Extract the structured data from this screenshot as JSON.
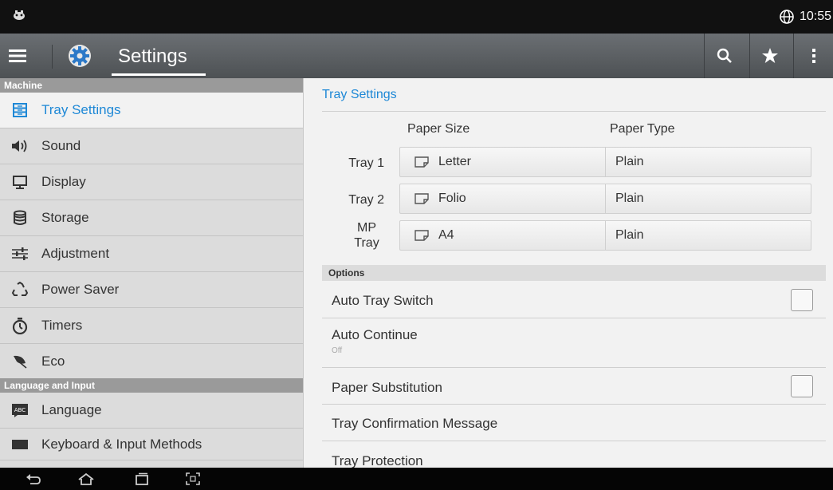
{
  "status_bar": {
    "time": "10:55"
  },
  "action_bar": {
    "title": "Settings"
  },
  "sidebar": {
    "section_machine": "Machine",
    "items": [
      {
        "label": "Tray Settings",
        "icon": "tray-icon"
      },
      {
        "label": "Sound",
        "icon": "speaker-icon"
      },
      {
        "label": "Display",
        "icon": "monitor-icon"
      },
      {
        "label": "Storage",
        "icon": "database-icon"
      },
      {
        "label": "Adjustment",
        "icon": "sliders-icon"
      },
      {
        "label": "Power Saver",
        "icon": "recycle-icon"
      },
      {
        "label": "Timers",
        "icon": "stopwatch-icon"
      },
      {
        "label": "Eco",
        "icon": "leaf-icon"
      }
    ],
    "section_language": "Language and Input",
    "language_items": [
      {
        "label": "Language",
        "icon": "abc-keyboard-icon"
      },
      {
        "label": "Keyboard & Input Methods",
        "icon": "keyboard-icon"
      }
    ]
  },
  "main": {
    "header": "Tray Settings",
    "col_paper_size": "Paper Size",
    "col_paper_type": "Paper Type",
    "trays": [
      {
        "label": "Tray 1",
        "size": "Letter",
        "type": "Plain"
      },
      {
        "label": "Tray 2",
        "size": "Folio",
        "type": "Plain"
      },
      {
        "label": "MP Tray",
        "size": "A4",
        "type": "Plain"
      }
    ],
    "options_header": "Options",
    "options": [
      {
        "label": "Auto Tray Switch",
        "sub": "",
        "checked": false
      },
      {
        "label": "Auto Continue",
        "sub": "Off"
      },
      {
        "label": "Paper Substitution",
        "sub": "",
        "checked": false
      },
      {
        "label": "Tray Confirmation Message",
        "sub": ""
      },
      {
        "label": "Tray Protection",
        "sub": ""
      }
    ]
  },
  "colors": {
    "accent": "#1e88d6",
    "actionbar": "#5a5e62",
    "sidebar_bg": "#dcdcdc",
    "section_header": "#9a9a9a"
  }
}
